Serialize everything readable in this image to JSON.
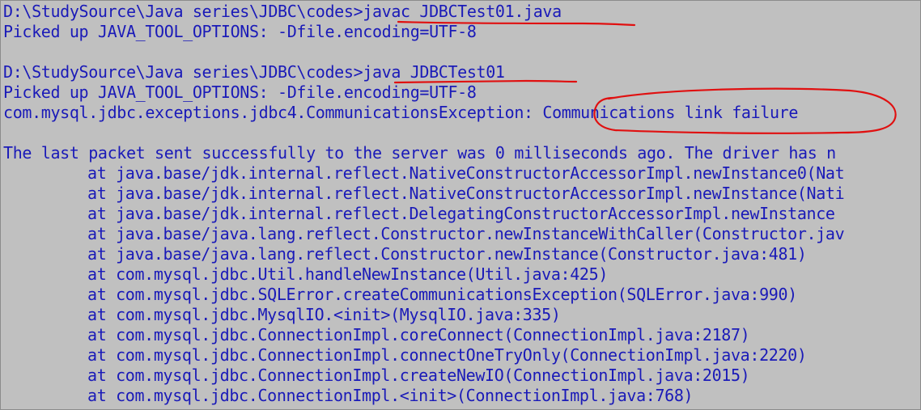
{
  "console": {
    "background": "#c0c0c0",
    "text_color": "#1a1ab8",
    "annotation_color": "#e01010",
    "lines": [
      "D:\\StudySource\\Java series\\JDBC\\codes>javac JDBCTest01.java",
      "Picked up JAVA_TOOL_OPTIONS: -Dfile.encoding=UTF-8",
      "",
      "D:\\StudySource\\Java series\\JDBC\\codes>java JDBCTest01",
      "Picked up JAVA_TOOL_OPTIONS: -Dfile.encoding=UTF-8",
      "com.mysql.jdbc.exceptions.jdbc4.CommunicationsException: Communications link failure",
      "",
      "The last packet sent successfully to the server was 0 milliseconds ago. The driver has n",
      "at java.base/jdk.internal.reflect.NativeConstructorAccessorImpl.newInstance0(Nat",
      "at java.base/jdk.internal.reflect.NativeConstructorAccessorImpl.newInstance(Nati",
      "at java.base/jdk.internal.reflect.DelegatingConstructorAccessorImpl.newInstance",
      "at java.base/java.lang.reflect.Constructor.newInstanceWithCaller(Constructor.jav",
      "at java.base/java.lang.reflect.Constructor.newInstance(Constructor.java:481)",
      "at com.mysql.jdbc.Util.handleNewInstance(Util.java:425)",
      "at com.mysql.jdbc.SQLError.createCommunicationsException(SQLError.java:990)",
      "at com.mysql.jdbc.MysqlIO.<init>(MysqlIO.java:335)",
      "at com.mysql.jdbc.ConnectionImpl.coreConnect(ConnectionImpl.java:2187)",
      "at com.mysql.jdbc.ConnectionImpl.connectOneTryOnly(ConnectionImpl.java:2220)",
      "at com.mysql.jdbc.ConnectionImpl.createNewIO(ConnectionImpl.java:2015)",
      "at com.mysql.jdbc.ConnectionImpl.<init>(ConnectionImpl.java:768)"
    ]
  }
}
